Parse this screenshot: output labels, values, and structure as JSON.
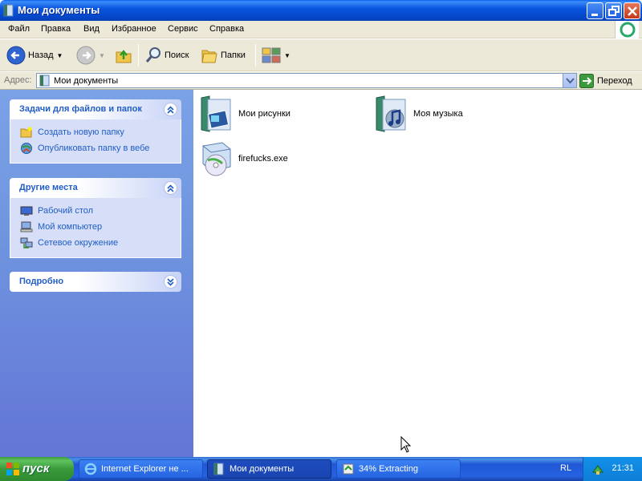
{
  "window": {
    "title": "Мои документы",
    "buttons": [
      "minimize-icon",
      "restore-icon",
      "close-icon"
    ]
  },
  "menubar": {
    "items": [
      "Файл",
      "Правка",
      "Вид",
      "Избранное",
      "Сервис",
      "Справка"
    ]
  },
  "toolbar": {
    "back_label": "Назад",
    "search_label": "Поиск",
    "folders_label": "Папки"
  },
  "address": {
    "label": "Адрес:",
    "value": "Мои документы",
    "go_label": "Переход"
  },
  "tasks_panel": {
    "title": "Задачи для файлов и папок",
    "items": [
      "Создать новую папку",
      "Опубликовать папку в вебе"
    ]
  },
  "places_panel": {
    "title": "Другие места",
    "items": [
      "Рабочий стол",
      "Мой компьютер",
      "Сетевое окружение"
    ]
  },
  "details_panel": {
    "title": "Подробно"
  },
  "files": [
    {
      "name": "Мои рисунки",
      "icon": "pictures-folder-icon"
    },
    {
      "name": "Моя музыка",
      "icon": "music-folder-icon"
    },
    {
      "name": "firefucks.exe",
      "icon": "installer-icon"
    }
  ],
  "taskbar": {
    "start_label": "пуск",
    "tasks": [
      {
        "label": "Internet Explorer не ...",
        "icon": "ie-icon"
      },
      {
        "label": "Мои документы",
        "icon": "folder-icon"
      },
      {
        "label": "34% Extracting",
        "icon": "extract-icon"
      }
    ],
    "lang": "RL",
    "clock": "21:31"
  },
  "colors": {
    "titlebar": "#0a56df",
    "left_pane": "#6f95df",
    "link": "#215dc6",
    "start": "#3a9a3a"
  }
}
